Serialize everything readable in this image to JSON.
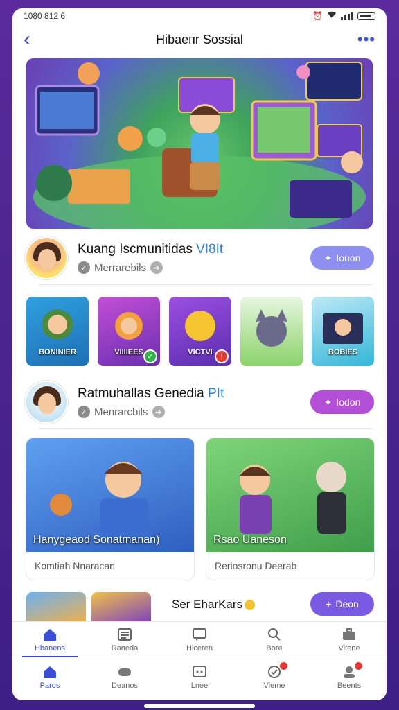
{
  "status_bar": {
    "time": "1080 812 6"
  },
  "app_bar": {
    "title": "Hibaeпr Sossial"
  },
  "hero": {
    "image": "social-gaming-community-illustration"
  },
  "communities": [
    {
      "name": "Kuang Iscmunitidas ",
      "name_accent": "VI8It",
      "sub": "Merrarebils",
      "button": "Iouon",
      "button_color": "#8e8ff0"
    },
    {
      "name": "Ratmuhallas Genedia ",
      "name_accent": "PIt",
      "sub": "Menrarcbils",
      "button": "Iodon",
      "button_color": "#b24fd6"
    }
  ],
  "games": [
    {
      "label": "BONINIER",
      "color": "#2fa0e0"
    },
    {
      "label": "VIIIIEES",
      "color": "#9b3fc4",
      "badge": "✓",
      "badge_color": "#2fb04a"
    },
    {
      "label": "VICTVI",
      "color": "#7a3ed0",
      "badge": "!",
      "badge_color": "#e53935"
    },
    {
      "label": "",
      "color": "#8ad26a"
    },
    {
      "label": "BOBIES",
      "color": "#32b6d8"
    }
  ],
  "cards": [
    {
      "caption": "Hanygeaod Sonatmanan)",
      "footer": "Komtiah Nnaracan",
      "color": "#3a6fd0"
    },
    {
      "caption": "Rsao Uaneson",
      "footer": "Reriosronu Deerab",
      "color": "#4fb45a"
    }
  ],
  "partial": {
    "name": "Ser EharKars",
    "button": "Deon"
  },
  "tabs_top": [
    {
      "label": "Hbanens",
      "icon": "home-icon",
      "active": true
    },
    {
      "label": "Raneda",
      "icon": "list-icon",
      "active": false
    },
    {
      "label": "Hiceren",
      "icon": "chat-icon",
      "active": false
    },
    {
      "label": "Bore",
      "icon": "search-icon",
      "active": false
    },
    {
      "label": "Vitene",
      "icon": "briefcase-icon",
      "active": false
    }
  ],
  "tabs_bottom": [
    {
      "label": "Paros",
      "icon": "home-icon",
      "active": true
    },
    {
      "label": "Deanos",
      "icon": "gamepad-icon",
      "active": false
    },
    {
      "label": "Lnee",
      "icon": "chat-icon",
      "active": false
    },
    {
      "label": "Vieme",
      "icon": "notification-icon",
      "active": false,
      "dot": true
    },
    {
      "label": "Beents",
      "icon": "profile-icon",
      "active": false,
      "dot": true
    }
  ],
  "colors": {
    "accent": "#3b4fd6",
    "background": "#4a2490"
  }
}
